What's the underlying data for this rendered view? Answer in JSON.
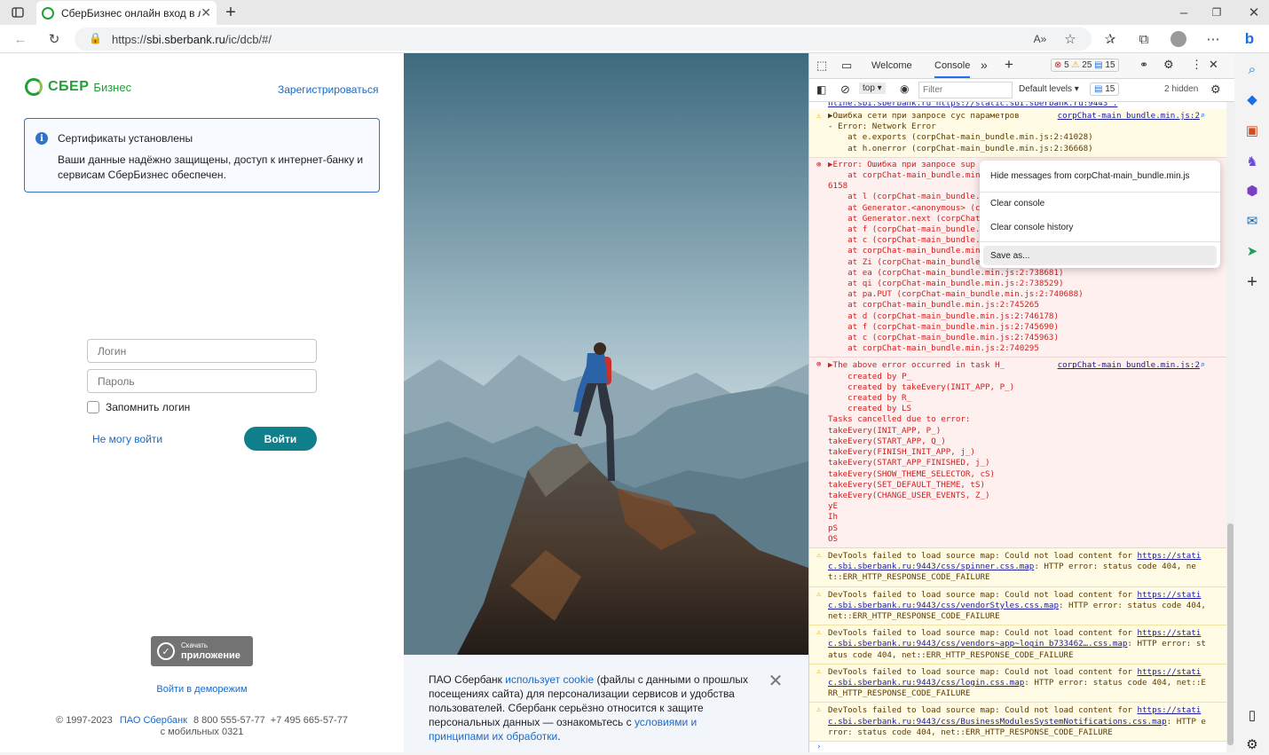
{
  "browser": {
    "tab_title": "СберБизнес онлайн вход в личн",
    "url_prefix": "https://",
    "url_host": "sbi.sberbank.ru",
    "url_path": "/ic/dcb/#/"
  },
  "login_page": {
    "logo_sber": "СБЕР",
    "logo_biz": "Бизнес",
    "register_link": "Зарегистрироваться",
    "cert_title": "Сертификаты установлены",
    "cert_text": "Ваши данные надёжно защищены, доступ к интернет-банку и сервисам СберБизнес обеспечен.",
    "login_placeholder": "Логин",
    "password_placeholder": "Пароль",
    "remember_label": "Запомнить логин",
    "cant_login": "Не могу войти",
    "login_button": "Войти",
    "app_small": "Скачать",
    "app_big": "приложение",
    "demo_link": "Войти в деморежим",
    "footer_copy": "© 1997-2023",
    "footer_company": "ПАО Сбербанк",
    "footer_phones": "8 800 555-57-77  +7 495 665-57-77",
    "footer_mobile": "с мобильных 0321"
  },
  "cookie_banner": {
    "part1": "ПАО Сбербанк ",
    "link1": "использует cookie",
    "part2": " (файлы с данными о прошлых посещениях сайта) для персонализации сервисов и удобства пользователей. Сбербанк серьёзно относится к защите персональных данных — ознакомьтесь с ",
    "link2": "условиями и принципами их обработки",
    "part3": "."
  },
  "devtools": {
    "tab_welcome": "Welcome",
    "tab_console": "Console",
    "badge_errors": "5",
    "badge_warnings": "25",
    "badge_info": "15",
    "context": "top",
    "filter_placeholder": "Filter",
    "levels": "Default levels",
    "issues": "15",
    "hidden": "2 hidden",
    "context_menu": [
      "Hide messages from corpChat-main_bundle.min.js",
      "Clear console",
      "Clear console history",
      "Save as..."
    ]
  },
  "console": {
    "top_line": "nline.sbi.sberbank.ru https://static.sbi.sberbank.ru:9443\".",
    "msg1": {
      "text": "▶Ошибка сети при запросе сус параметров",
      "src": "corpChat-main_bundle.min.js:2",
      "lines": [
        "- Error: Network Error",
        "    at e.exports (corpChat-main_bundle.min.js:2:41028)",
        "    at h.onerror (corpChat-main_bundle.min.js:2:36668)"
      ]
    },
    "msg2": {
      "text": "▶Error: Ошибка при запросе sup",
      "lines": [
        "    at corpChat-main_bundle.min",
        "6158",
        "    at l (corpChat-main_bundle.",
        "    at Generator.<anonymous> (c",
        "    at Generator.next (corpChat",
        "    at f (corpChat-main_bundle.",
        "    at c (corpChat-main_bundle.",
        "    at corpChat-main_bundle.min",
        "    at Zi (corpChat-main_bundle",
        "    at ea (corpChat-main_bundle.min.js:2:738681)",
        "    at qi (corpChat-main_bundle.min.js:2:738529)",
        "    at pa.PUT (corpChat-main_bundle.min.js:2:740688)",
        "    at corpChat-main_bundle.min.js:2:745265",
        "    at d (corpChat-main_bundle.min.js:2:746178)",
        "    at f (corpChat-main_bundle.min.js:2:745690)",
        "    at c (corpChat-main_bundle.min.js:2:745963)",
        "    at corpChat-main_bundle.min.js:2:740295"
      ]
    },
    "msg3": {
      "text": "▶The above error occurred in task H_",
      "src": "corpChat-main_bundle.min.js:2",
      "lines": [
        "    created by P_",
        "    created by takeEvery(INIT_APP, P_)",
        "    created by R_",
        "    created by LS",
        "Tasks cancelled due to error:",
        "takeEvery(INIT_APP, P_)",
        "takeEvery(START_APP, Q_)",
        "takeEvery(FINISH_INIT_APP, j_)",
        "takeEvery(START_APP_FINISHED, j_)",
        "takeEvery(SHOW_THEME_SELECTOR, cS)",
        "takeEvery(SET_DEFAULT_THEME, tS)",
        "takeEvery(CHANGE_USER_EVENTS, Z_)",
        "yE",
        "Ih",
        "pS",
        "OS"
      ]
    },
    "warnings": [
      [
        "DevTools failed to load source map: Could not load content for ",
        "https://static.sbi.sberbank.ru:9443/css/spinner.css.map",
        ": HTTP error: status code 404, net::ERR_HTTP_RESPONSE_CODE_FAILURE"
      ],
      [
        "DevTools failed to load source map: Could not load content for ",
        "https://static.sbi.sberbank.ru:9443/css/vendorStyles.css.map",
        ": HTTP error: status code 404, net::ERR_HTTP_RESPONSE_CODE_FAILURE"
      ],
      [
        "DevTools failed to load source map: Could not load content for ",
        "https://static.sbi.sberbank.ru:9443/css/vendors~app~login_b733462….css.map",
        ": HTTP error: status code 404, net::ERR_HTTP_RESPONSE_CODE_FAILURE"
      ],
      [
        "DevTools failed to load source map: Could not load content for ",
        "https://static.sbi.sberbank.ru:9443/css/login.css.map",
        ": HTTP error: status code 404, net::ERR_HTTP_RESPONSE_CODE_FAILURE"
      ],
      [
        "DevTools failed to load source map: Could not load content for ",
        "https://static.sbi.sberbank.ru:9443/css/BusinessModulesSystemNotifications.css.map",
        ": HTTP error: status code 404, net::ERR_HTTP_RESPONSE_CODE_FAILURE"
      ]
    ]
  }
}
